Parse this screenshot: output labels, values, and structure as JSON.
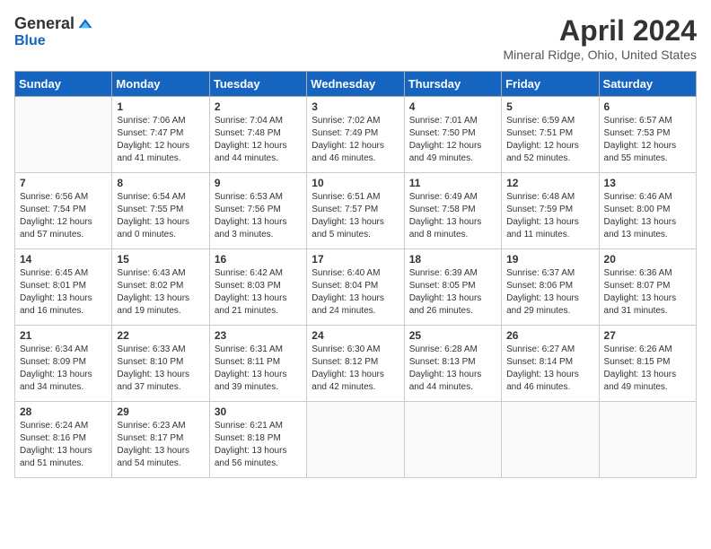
{
  "header": {
    "logo_general": "General",
    "logo_blue": "Blue",
    "month_title": "April 2024",
    "location": "Mineral Ridge, Ohio, United States"
  },
  "weekdays": [
    "Sunday",
    "Monday",
    "Tuesday",
    "Wednesday",
    "Thursday",
    "Friday",
    "Saturday"
  ],
  "weeks": [
    [
      {
        "day": "",
        "info": ""
      },
      {
        "day": "1",
        "info": "Sunrise: 7:06 AM\nSunset: 7:47 PM\nDaylight: 12 hours\nand 41 minutes."
      },
      {
        "day": "2",
        "info": "Sunrise: 7:04 AM\nSunset: 7:48 PM\nDaylight: 12 hours\nand 44 minutes."
      },
      {
        "day": "3",
        "info": "Sunrise: 7:02 AM\nSunset: 7:49 PM\nDaylight: 12 hours\nand 46 minutes."
      },
      {
        "day": "4",
        "info": "Sunrise: 7:01 AM\nSunset: 7:50 PM\nDaylight: 12 hours\nand 49 minutes."
      },
      {
        "day": "5",
        "info": "Sunrise: 6:59 AM\nSunset: 7:51 PM\nDaylight: 12 hours\nand 52 minutes."
      },
      {
        "day": "6",
        "info": "Sunrise: 6:57 AM\nSunset: 7:53 PM\nDaylight: 12 hours\nand 55 minutes."
      }
    ],
    [
      {
        "day": "7",
        "info": "Sunrise: 6:56 AM\nSunset: 7:54 PM\nDaylight: 12 hours\nand 57 minutes."
      },
      {
        "day": "8",
        "info": "Sunrise: 6:54 AM\nSunset: 7:55 PM\nDaylight: 13 hours\nand 0 minutes."
      },
      {
        "day": "9",
        "info": "Sunrise: 6:53 AM\nSunset: 7:56 PM\nDaylight: 13 hours\nand 3 minutes."
      },
      {
        "day": "10",
        "info": "Sunrise: 6:51 AM\nSunset: 7:57 PM\nDaylight: 13 hours\nand 5 minutes."
      },
      {
        "day": "11",
        "info": "Sunrise: 6:49 AM\nSunset: 7:58 PM\nDaylight: 13 hours\nand 8 minutes."
      },
      {
        "day": "12",
        "info": "Sunrise: 6:48 AM\nSunset: 7:59 PM\nDaylight: 13 hours\nand 11 minutes."
      },
      {
        "day": "13",
        "info": "Sunrise: 6:46 AM\nSunset: 8:00 PM\nDaylight: 13 hours\nand 13 minutes."
      }
    ],
    [
      {
        "day": "14",
        "info": "Sunrise: 6:45 AM\nSunset: 8:01 PM\nDaylight: 13 hours\nand 16 minutes."
      },
      {
        "day": "15",
        "info": "Sunrise: 6:43 AM\nSunset: 8:02 PM\nDaylight: 13 hours\nand 19 minutes."
      },
      {
        "day": "16",
        "info": "Sunrise: 6:42 AM\nSunset: 8:03 PM\nDaylight: 13 hours\nand 21 minutes."
      },
      {
        "day": "17",
        "info": "Sunrise: 6:40 AM\nSunset: 8:04 PM\nDaylight: 13 hours\nand 24 minutes."
      },
      {
        "day": "18",
        "info": "Sunrise: 6:39 AM\nSunset: 8:05 PM\nDaylight: 13 hours\nand 26 minutes."
      },
      {
        "day": "19",
        "info": "Sunrise: 6:37 AM\nSunset: 8:06 PM\nDaylight: 13 hours\nand 29 minutes."
      },
      {
        "day": "20",
        "info": "Sunrise: 6:36 AM\nSunset: 8:07 PM\nDaylight: 13 hours\nand 31 minutes."
      }
    ],
    [
      {
        "day": "21",
        "info": "Sunrise: 6:34 AM\nSunset: 8:09 PM\nDaylight: 13 hours\nand 34 minutes."
      },
      {
        "day": "22",
        "info": "Sunrise: 6:33 AM\nSunset: 8:10 PM\nDaylight: 13 hours\nand 37 minutes."
      },
      {
        "day": "23",
        "info": "Sunrise: 6:31 AM\nSunset: 8:11 PM\nDaylight: 13 hours\nand 39 minutes."
      },
      {
        "day": "24",
        "info": "Sunrise: 6:30 AM\nSunset: 8:12 PM\nDaylight: 13 hours\nand 42 minutes."
      },
      {
        "day": "25",
        "info": "Sunrise: 6:28 AM\nSunset: 8:13 PM\nDaylight: 13 hours\nand 44 minutes."
      },
      {
        "day": "26",
        "info": "Sunrise: 6:27 AM\nSunset: 8:14 PM\nDaylight: 13 hours\nand 46 minutes."
      },
      {
        "day": "27",
        "info": "Sunrise: 6:26 AM\nSunset: 8:15 PM\nDaylight: 13 hours\nand 49 minutes."
      }
    ],
    [
      {
        "day": "28",
        "info": "Sunrise: 6:24 AM\nSunset: 8:16 PM\nDaylight: 13 hours\nand 51 minutes."
      },
      {
        "day": "29",
        "info": "Sunrise: 6:23 AM\nSunset: 8:17 PM\nDaylight: 13 hours\nand 54 minutes."
      },
      {
        "day": "30",
        "info": "Sunrise: 6:21 AM\nSunset: 8:18 PM\nDaylight: 13 hours\nand 56 minutes."
      },
      {
        "day": "",
        "info": ""
      },
      {
        "day": "",
        "info": ""
      },
      {
        "day": "",
        "info": ""
      },
      {
        "day": "",
        "info": ""
      }
    ]
  ]
}
